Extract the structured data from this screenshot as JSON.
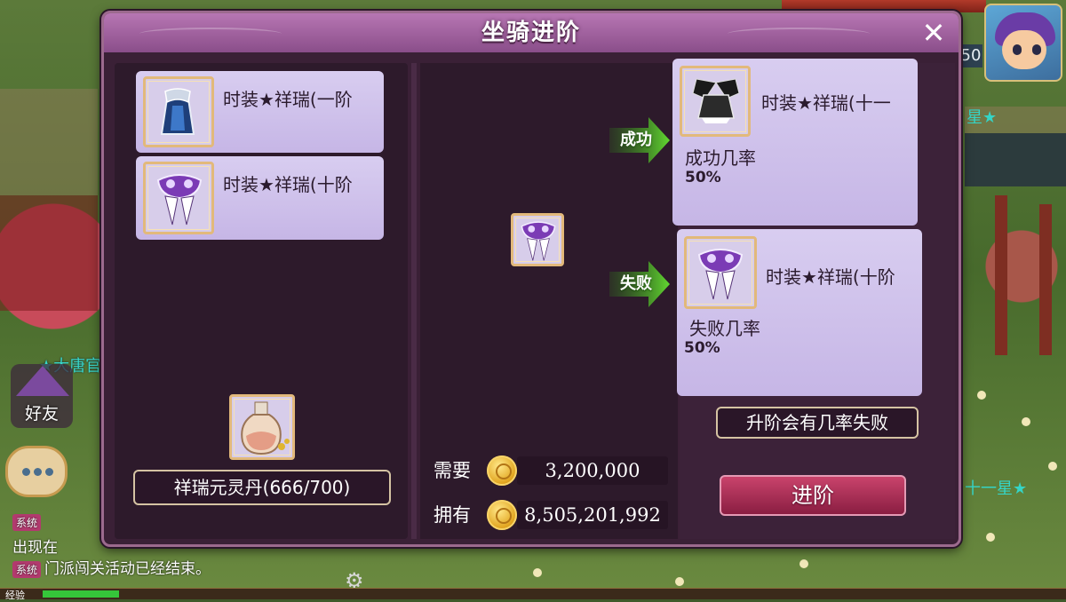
{
  "dialog": {
    "title": "坐骑进阶",
    "close_icon": "close-icon"
  },
  "left": {
    "items": [
      {
        "name": "时装★祥瑞(一阶",
        "icon": "robe-icon"
      },
      {
        "name": "时装★祥瑞(十阶",
        "icon": "mask-icon"
      }
    ],
    "material": {
      "name": "祥瑞元灵丹(666/700)",
      "icon": "potion-icon"
    }
  },
  "center": {
    "preview_icon": "mask-icon",
    "cost": {
      "need_label": "需要",
      "need_value": "3,200,000",
      "have_label": "拥有",
      "have_value": "8,505,201,992",
      "currency_icon": "gold-coin-icon"
    }
  },
  "right": {
    "success": {
      "arrow_label": "成功",
      "item_name": "时装★祥瑞(十一",
      "rate_label": "成功几率",
      "rate_value": "50%",
      "icon": "dark-wing-icon"
    },
    "failure": {
      "arrow_label": "失败",
      "item_name": "时装★祥瑞(十阶",
      "rate_label": "失败几率",
      "rate_value": "50%",
      "icon": "mask-icon"
    },
    "info_button": "升阶会有几率失败",
    "advance_button": "进阶"
  },
  "hud": {
    "friends_label": "好友",
    "side_text_left": "★大唐官",
    "side_text_right_top": "星★",
    "side_text_right_bottom": "十一星★",
    "counter": "50",
    "system_tag": "系统",
    "system_lines": [
      "出现在",
      "门派闯关活动已经结束。"
    ],
    "exp_label": "经验"
  },
  "colors": {
    "dialog_bg": "#3a2036",
    "header_purple": "#8a4e8a",
    "card_lavender": "#d8cdf0",
    "arrow_green": "#4cc428",
    "advance_button": "#b23158"
  }
}
